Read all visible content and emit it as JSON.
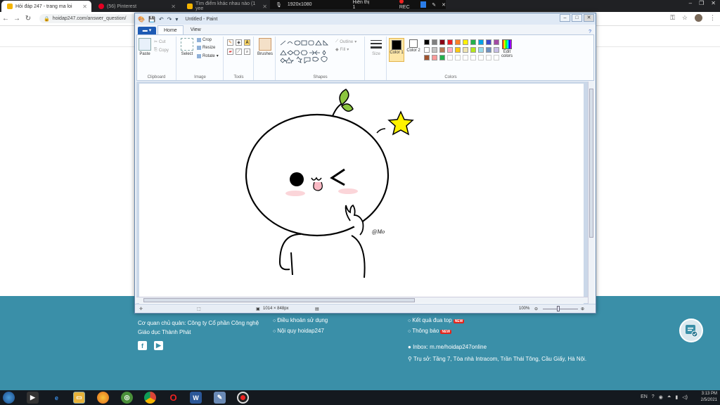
{
  "browser": {
    "tabs": [
      {
        "title": "Hỏi đáp 247 - trang ma loi",
        "active": true,
        "color": "#f4b400"
      },
      {
        "title": "(56) Pinterest",
        "active": false,
        "color": "#e60023"
      },
      {
        "title": "Tìm điểm khác nhau nào (1 yee",
        "active": false,
        "color": "#f4b400"
      }
    ],
    "recorder": {
      "resolution": "1920x1080",
      "mode": "Hiển thị 1",
      "rec": "REC"
    },
    "url": "hoidap247.com/answer_question/"
  },
  "paint": {
    "title": "Untitled - Paint",
    "tabs": {
      "home": "Home",
      "view": "View"
    },
    "clipboard": {
      "paste": "Paste",
      "cut": "Cut",
      "copy": "Copy",
      "label": "Clipboard"
    },
    "image": {
      "select": "Select",
      "crop": "Crop",
      "resize": "Resize",
      "rotate": "Rotate",
      "label": "Image"
    },
    "tools": {
      "label": "Tools"
    },
    "brushes": {
      "label": "Brushes"
    },
    "shapes": {
      "outline": "Outline",
      "fill": "Fill",
      "label": "Shapes"
    },
    "size": {
      "label": "Size"
    },
    "colors": {
      "color1": "Color 1",
      "color2": "Color 2",
      "edit": "Edit colors",
      "label": "Colors",
      "color1_value": "#000000",
      "color2_value": "#ffffff",
      "palette": [
        "#000000",
        "#7f7f7f",
        "#880015",
        "#ed1c24",
        "#ff7f27",
        "#fff200",
        "#22b14c",
        "#00a2e8",
        "#3f48cc",
        "#a349a4",
        "#ffffff",
        "#c3c3c3",
        "#b97a57",
        "#ffaec9",
        "#ffc90e",
        "#efe4b0",
        "#b5e61d",
        "#99d9ea",
        "#7092be",
        "#c8bfe7",
        "#a0522d",
        "#ff9999",
        "#22b14c",
        "#ffffff",
        "#ffffff",
        "#ffffff",
        "#ffffff",
        "#ffffff",
        "#ffffff",
        "#ffffff"
      ]
    },
    "canvas": {
      "signature": "@Mo"
    },
    "status": {
      "size": "1014 × 848px",
      "zoom": "100%"
    }
  },
  "footer": {
    "company_line1": "Cơ quan chủ quản: Công ty Cổ phần Công nghệ",
    "company_line2": "Giáo dục Thành Phát",
    "terms": "Điều khoản sử dụng",
    "rules": "Nội quy hoidap247",
    "ranking": "Kết quả đua top",
    "notice": "Thông báo",
    "new": "NEW",
    "inbox": "Inbox: m.me/hoidap247online",
    "address": "Trụ sở: Tầng 7, Tòa nhà Intracom, Trần Thái Tông, Cầu Giấy, Hà Nội."
  },
  "taskbar": {
    "time": "3:13 PM",
    "date": "2/5/2021",
    "lang": "EN"
  }
}
